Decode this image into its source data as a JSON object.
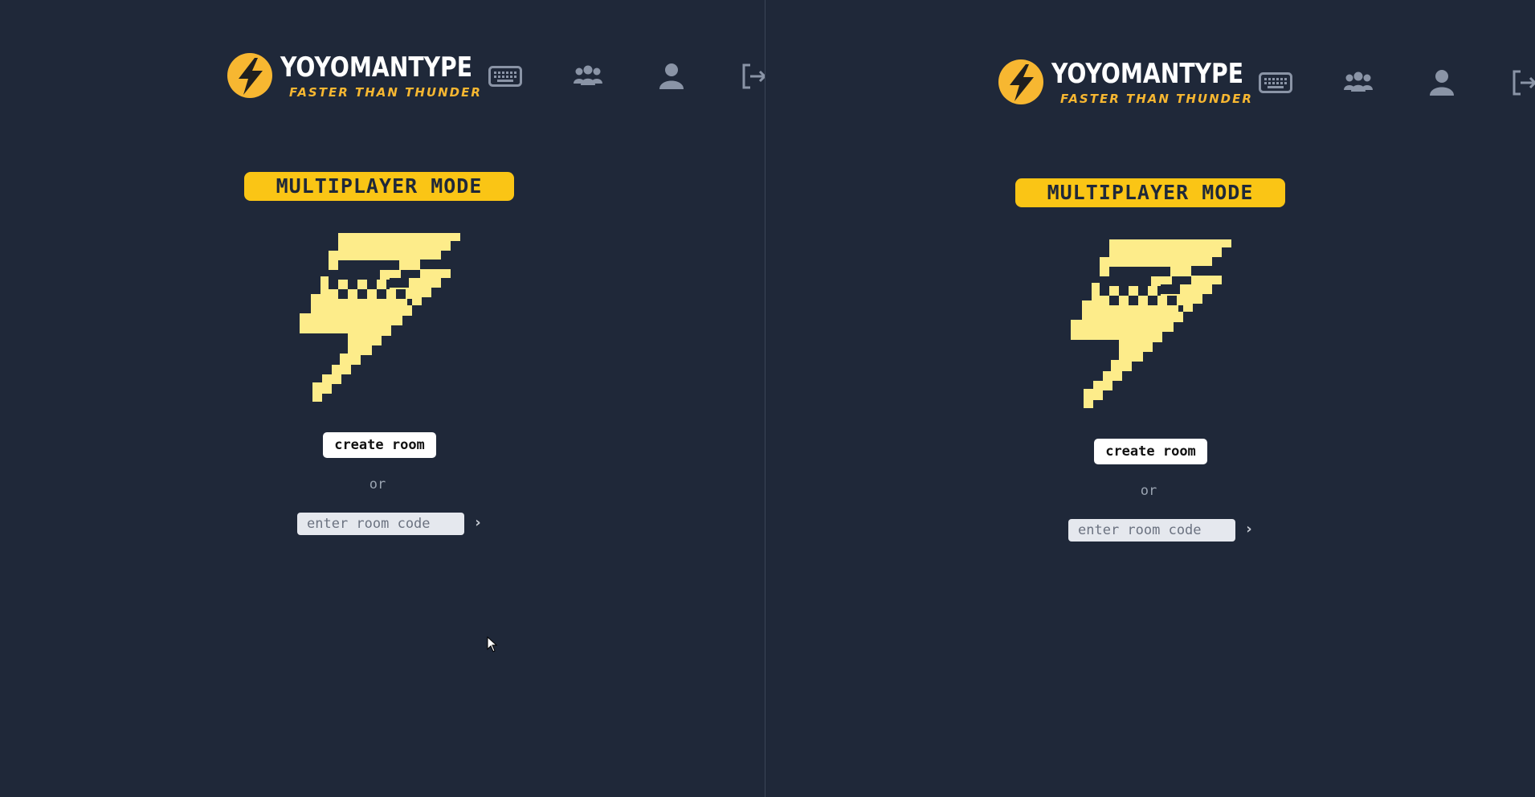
{
  "brand": {
    "title": "YOYOMANTYPE",
    "tagline": "FASTER THAN THUNDER",
    "logo_icon": "lightning-bolt-icon"
  },
  "nav": [
    {
      "name": "keyboard-icon",
      "label": "typing test"
    },
    {
      "name": "group-icon",
      "label": "multiplayer"
    },
    {
      "name": "user-icon",
      "label": "profile"
    },
    {
      "name": "logout-icon",
      "label": "logout"
    }
  ],
  "main": {
    "mode_title": "MULTIPLAYER MODE",
    "create_room_label": "create room",
    "or_text": "or",
    "room_code_placeholder": "enter room code",
    "room_code_value": "",
    "go_icon": "chevron-right-icon"
  },
  "colors": {
    "background": "#1f2839",
    "accent_yellow": "#fac515",
    "logo_orange": "#f7b731",
    "pixel_bolt": "#fdec8a",
    "nav_icon": "#8a94a6"
  }
}
